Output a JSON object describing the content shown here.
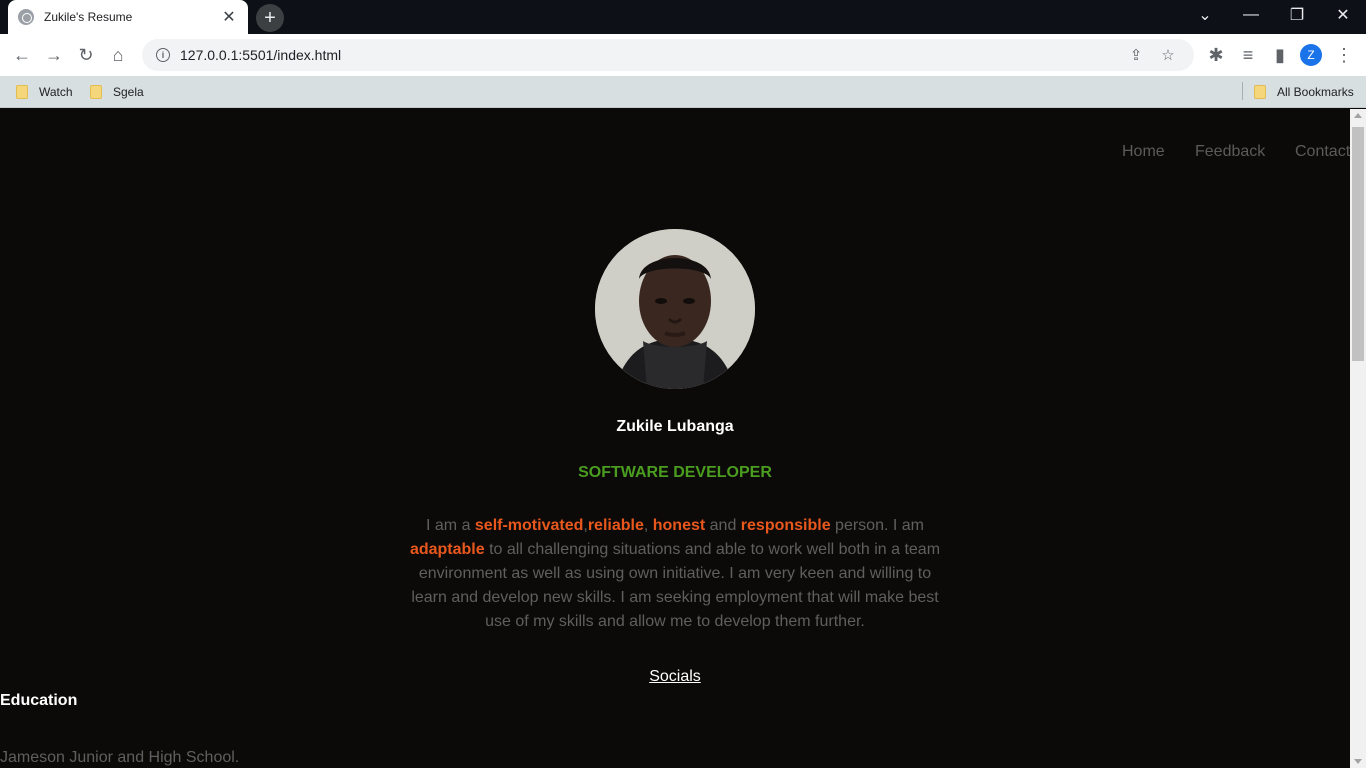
{
  "browser": {
    "tab_title": "Zukile's Resume",
    "url": "127.0.0.1:5501/index.html",
    "profile_initial": "Z",
    "bookmarks": [
      "Watch",
      "Sgela"
    ],
    "all_bookmarks": "All Bookmarks"
  },
  "page": {
    "nav": [
      "Home",
      "Feedback",
      "Contact"
    ],
    "name": "Zukile Lubanga",
    "role": "SOFTWARE DEVELOPER",
    "bio": {
      "p1": "I am a ",
      "h1": "self-motivated",
      "p2": ",",
      "h2": "reliable",
      "p3": ", ",
      "h3": "honest",
      "p4": " and ",
      "h4": "responsible",
      "p5": " person. I am ",
      "h5": "adaptable",
      "p6": " to all challenging situations and able to work well both in a team environment as well as using own initiative. I am very keen and willing to learn and develop new skills. I am seeking employment that will make best use of my skills and allow me to develop them further."
    },
    "socials_label": "Socials",
    "education_heading": "Education",
    "education_school": "Jameson Junior and High School."
  },
  "colors": {
    "background": "#0c0a09",
    "accent_green": "#4a9d1f",
    "highlight_orange": "#e8571c",
    "muted_text": "#5f5f5f"
  }
}
